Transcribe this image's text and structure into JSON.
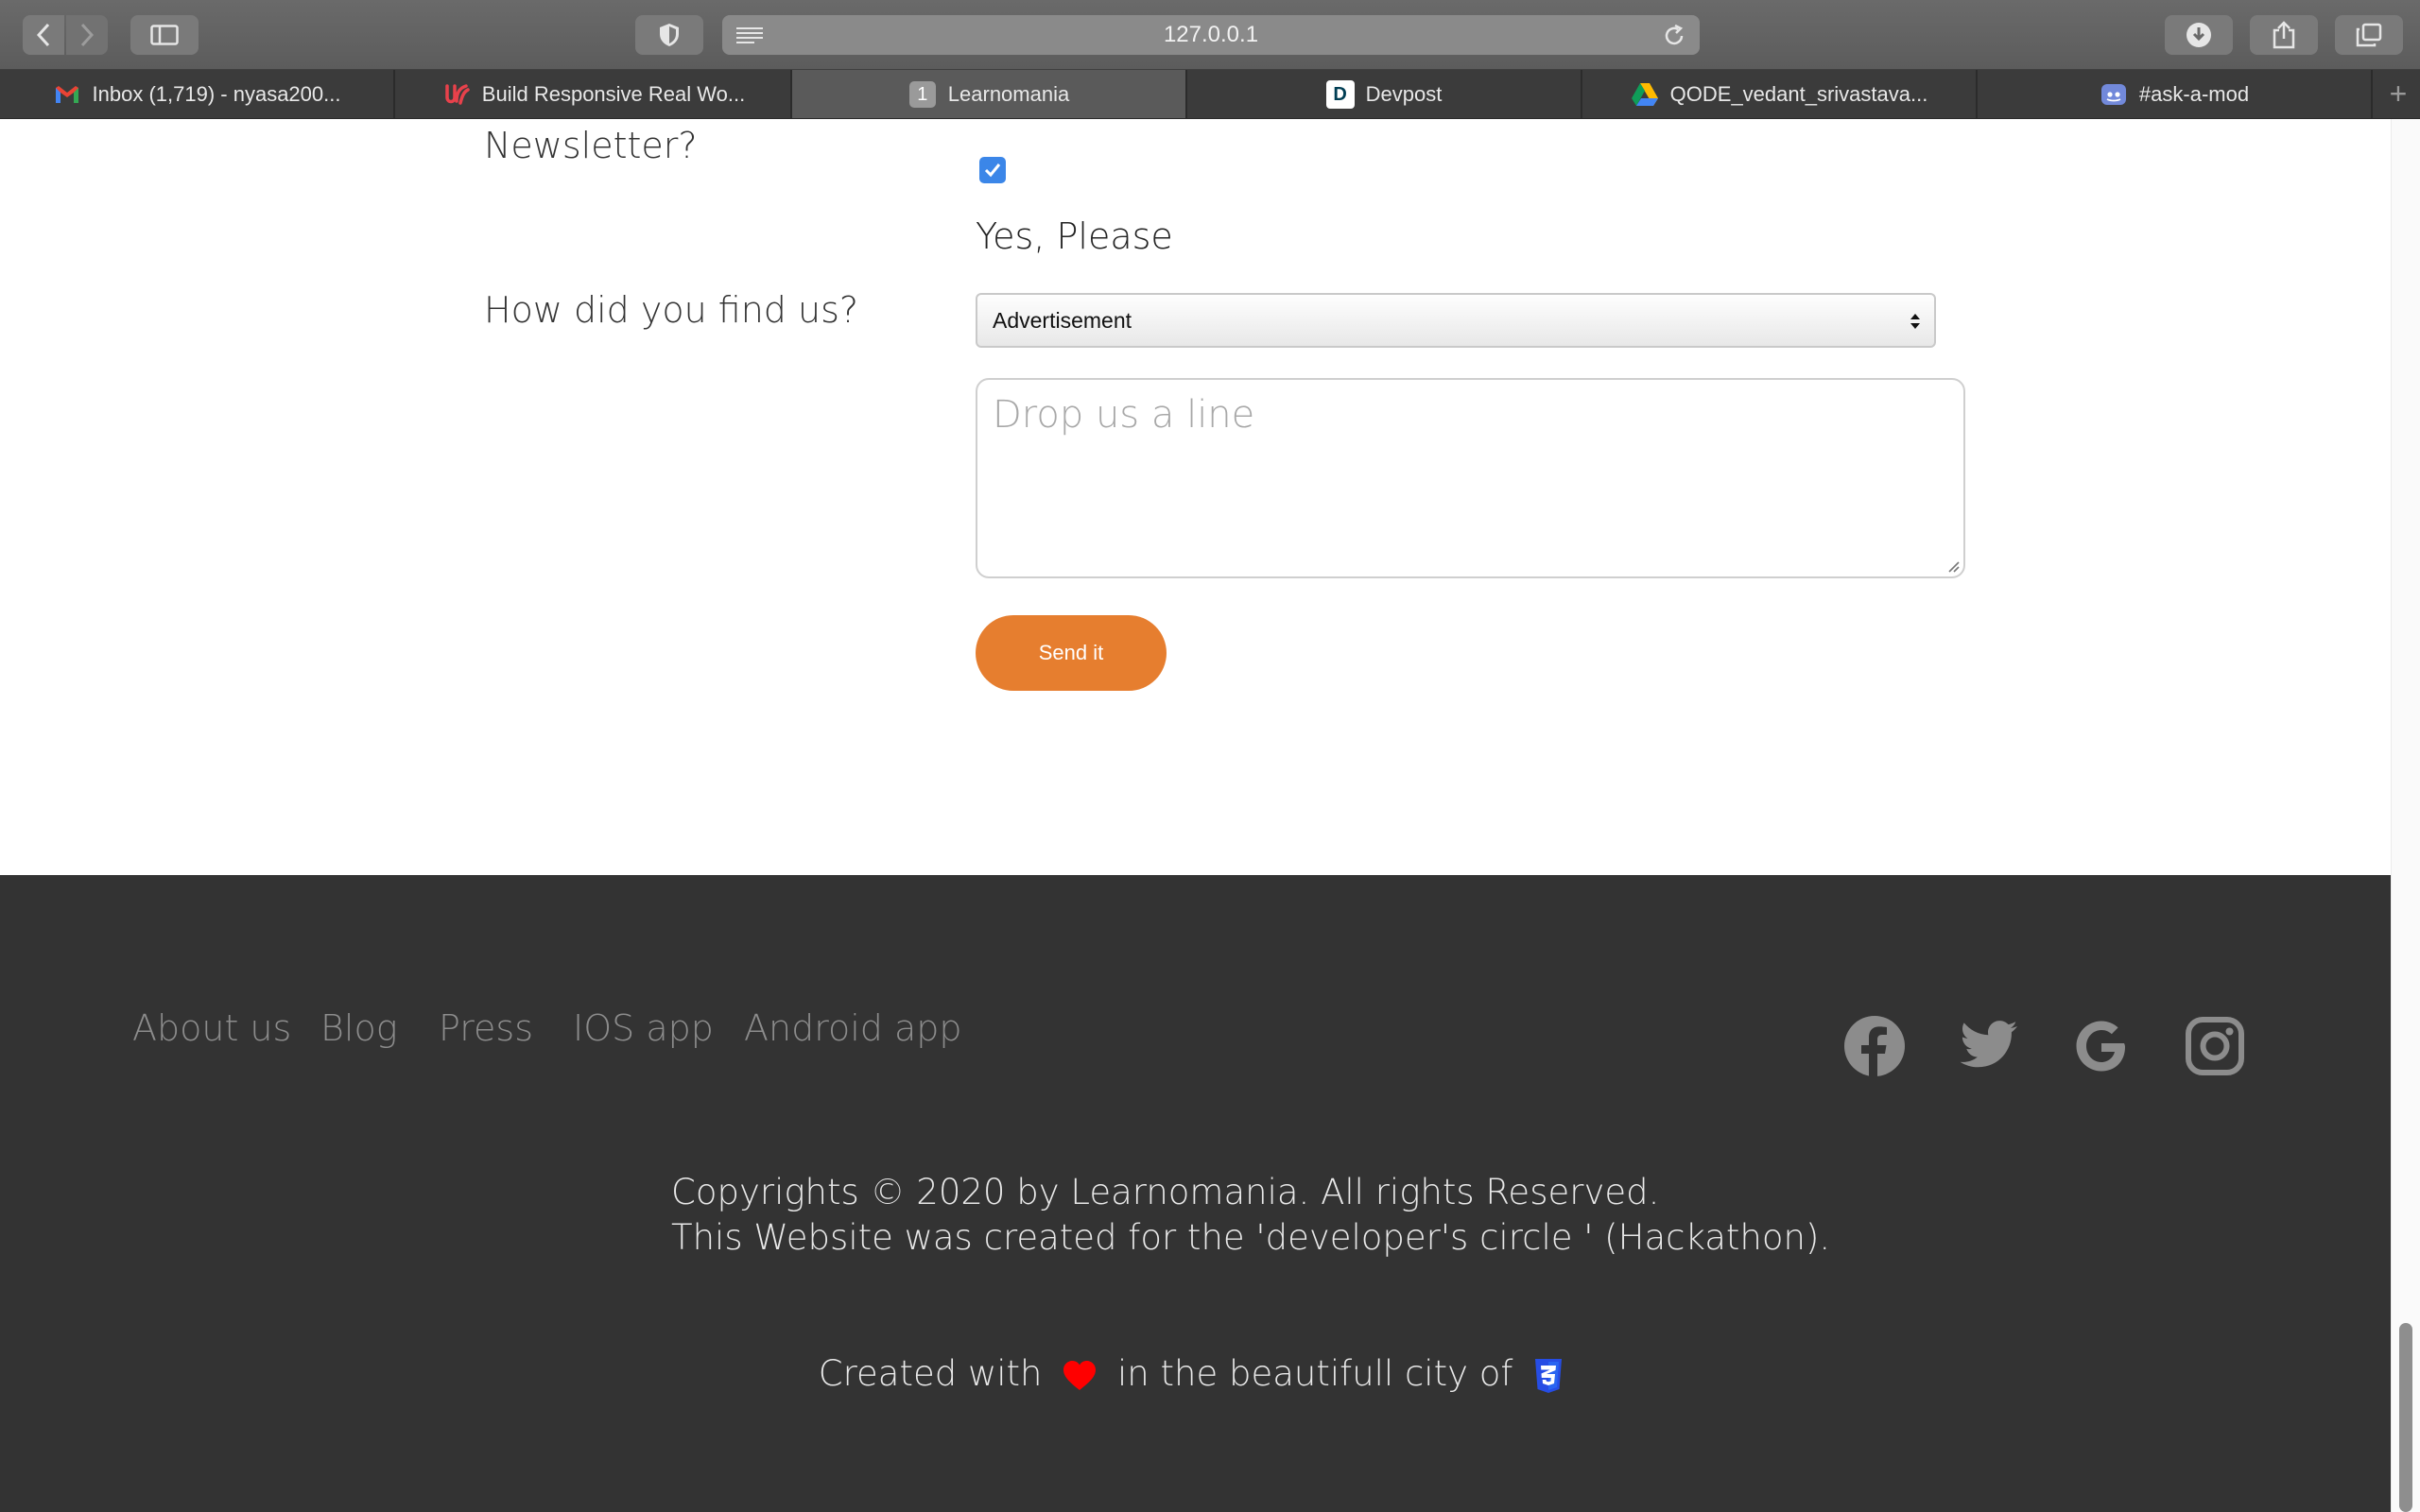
{
  "browser": {
    "url": "127.0.0.1",
    "tabs": [
      {
        "label": "Inbox (1,719) - nyasa200...",
        "icon": "gmail-icon",
        "active": false
      },
      {
        "label": "Build Responsive Real Wo...",
        "icon": "udemy-icon",
        "active": false
      },
      {
        "label": "Learnomania",
        "icon": "number-one-badge-icon",
        "badge": "1",
        "active": true
      },
      {
        "label": "Devpost",
        "icon": "devpost-icon",
        "badge": "D",
        "active": false
      },
      {
        "label": "QODE_vedant_srivastava...",
        "icon": "google-drive-icon",
        "active": false
      },
      {
        "label": "#ask-a-mod",
        "icon": "discord-icon",
        "active": false
      }
    ]
  },
  "form": {
    "newsletter_label": "Newsletter?",
    "newsletter_checked": true,
    "newsletter_option": "Yes, Please",
    "find_label": "How did you find us?",
    "find_selected": "Advertisement",
    "message_placeholder": "Drop us a line",
    "send_label": "Send it",
    "accent_color": "#e67e2f"
  },
  "footer": {
    "nav": [
      "About us",
      "Blog",
      "Press",
      "IOS app",
      "Android app"
    ],
    "social_icons": [
      "facebook-icon",
      "twitter-icon",
      "google-icon",
      "instagram-icon"
    ],
    "copyright_line1": "Copyrights © 2020 by Learnomania. All rights Reserved.",
    "copyright_line2": "This Website was created for the 'developer's circle ' (Hackathon).",
    "created_prefix": "Created with",
    "created_middle": "in the beautifull city of",
    "background_color": "#333333"
  }
}
